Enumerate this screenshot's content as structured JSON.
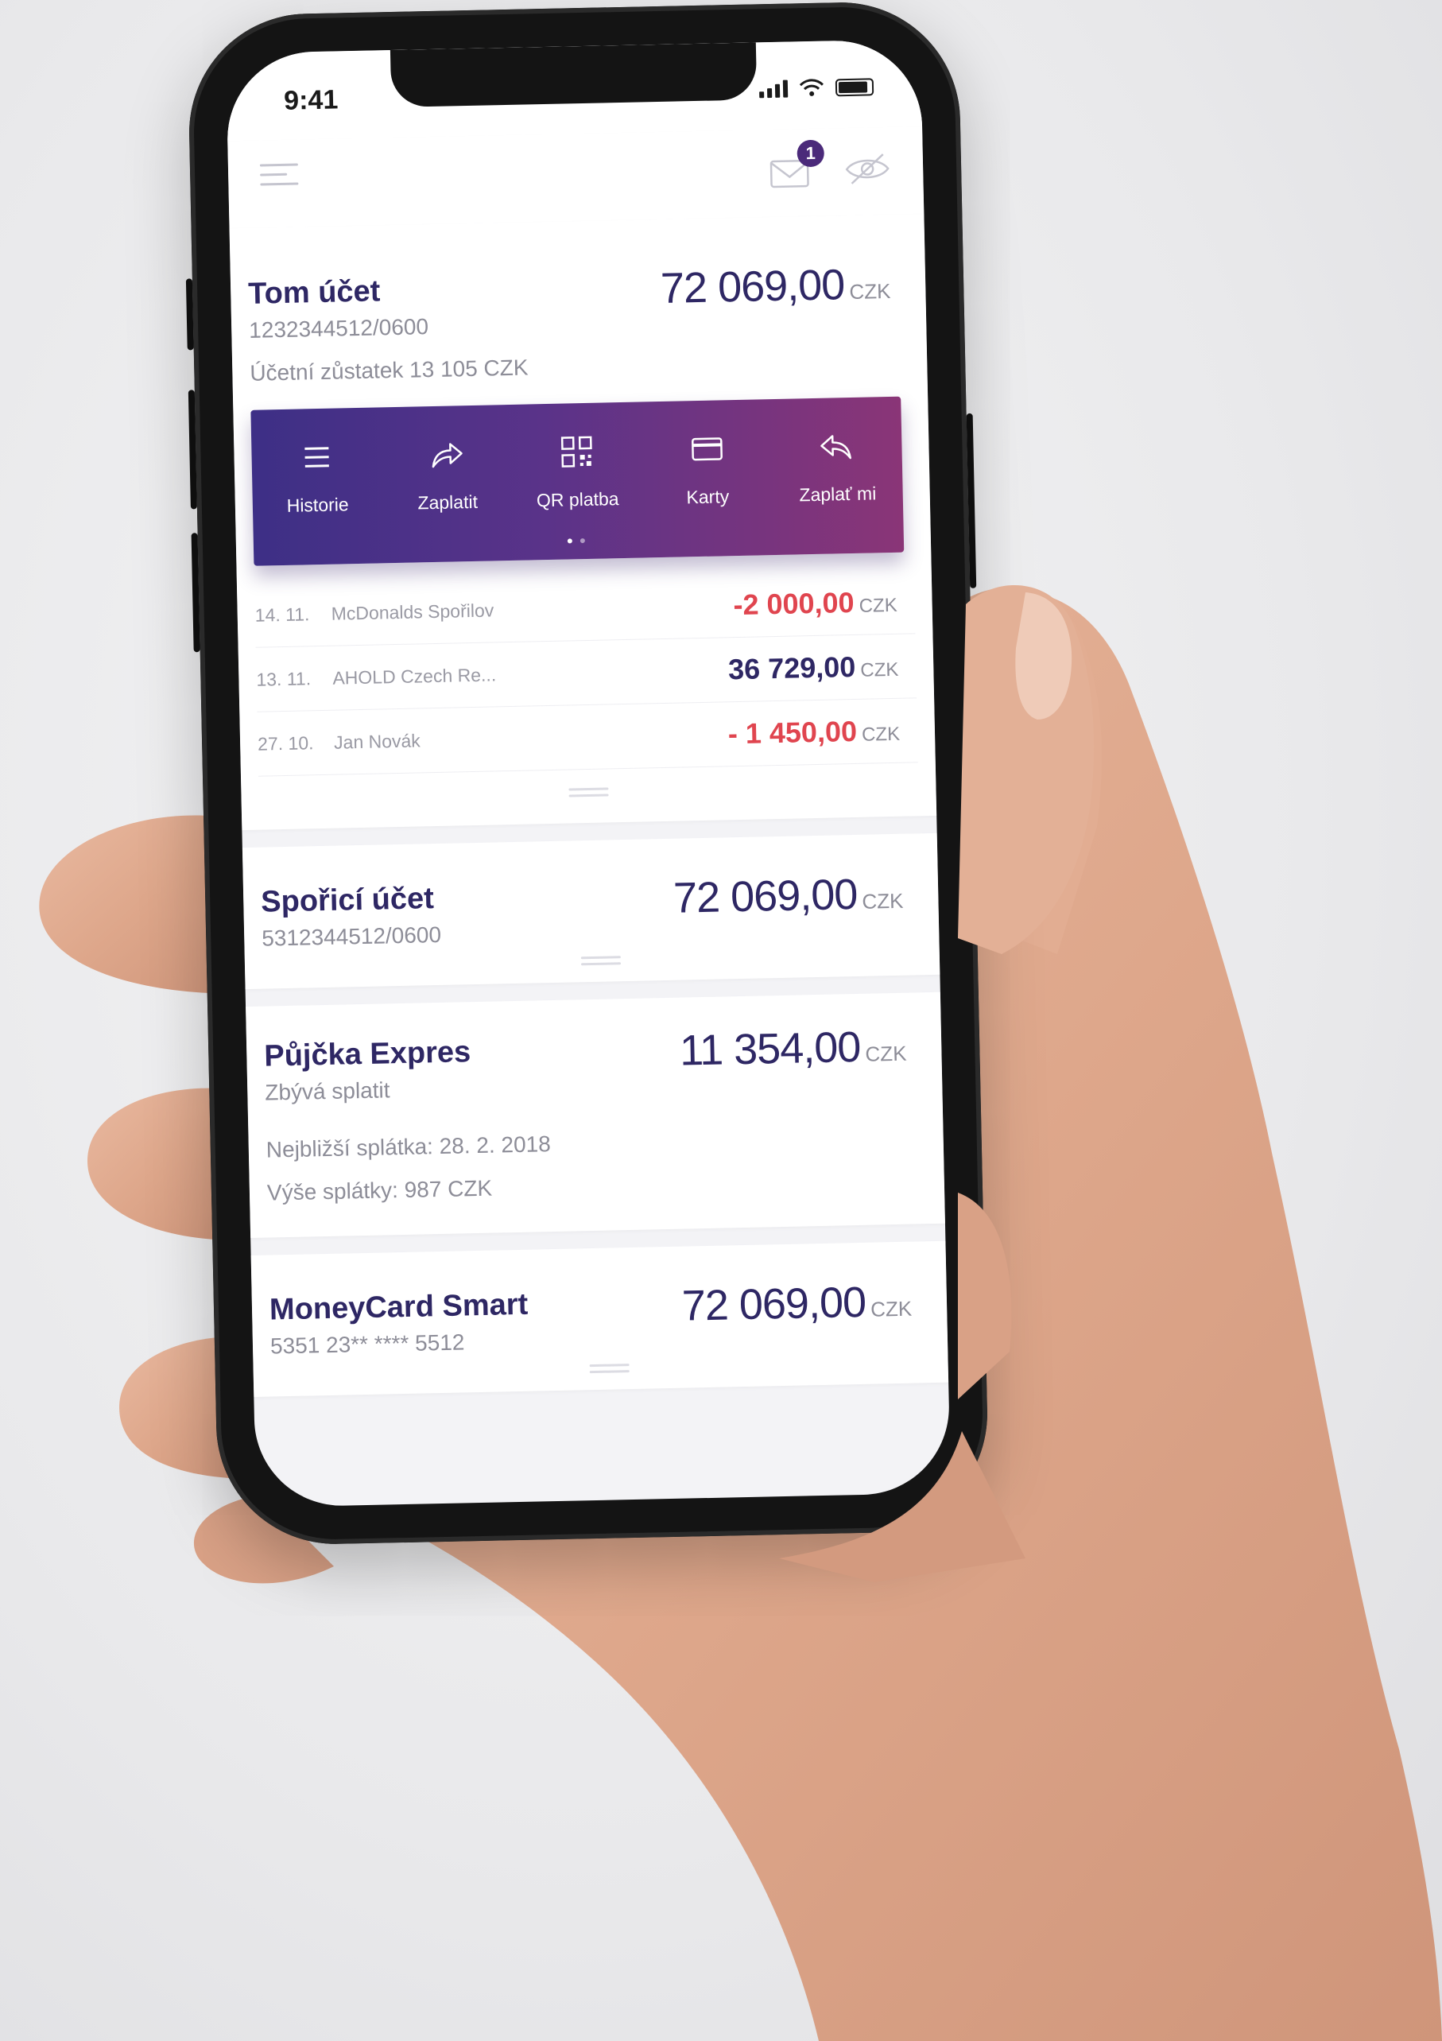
{
  "status_bar": {
    "time": "9:41"
  },
  "app_bar": {
    "notification_count": "1"
  },
  "main_account": {
    "name": "Tom účet",
    "number": "1232344512/0600",
    "accounting_balance": "Účetní zůstatek 13 105 CZK",
    "amount": "72 069,00",
    "currency": "CZK"
  },
  "actions": [
    {
      "label": "Historie",
      "icon": "list-icon"
    },
    {
      "label": "Zaplatit",
      "icon": "share-arrow-icon"
    },
    {
      "label": "QR platba",
      "icon": "qr-code-icon"
    },
    {
      "label": "Karty",
      "icon": "card-icon"
    },
    {
      "label": "Zaplať mi",
      "icon": "reply-arrow-icon"
    }
  ],
  "transactions": [
    {
      "date": "14. 11.",
      "description": "McDonalds Spořilov",
      "amount": "-2 000,00",
      "currency": "CZK",
      "type": "negative"
    },
    {
      "date": "13. 11.",
      "description": "AHOLD Czech Re...",
      "amount": "36 729,00",
      "currency": "CZK",
      "type": "positive"
    },
    {
      "date": "27. 10.",
      "description": "Jan Novák",
      "amount": "- 1 450,00",
      "currency": "CZK",
      "type": "negative"
    }
  ],
  "savings_account": {
    "name": "Spořicí účet",
    "number": "5312344512/0600",
    "amount": "72 069,00",
    "currency": "CZK"
  },
  "loan": {
    "name": "Půjčka Expres",
    "remaining_label": "Zbývá splatit",
    "next_payment": "Nejbližší splátka: 28. 2. 2018",
    "payment_amount": "Výše splátky: 987 CZK",
    "amount": "11 354,00",
    "currency": "CZK"
  },
  "card": {
    "name": "MoneyCard Smart",
    "number": "5351 23** **** 5512",
    "amount": "72 069,00",
    "currency": "CZK"
  },
  "colors": {
    "brand_dark": "#2e2764",
    "gradient_start": "#3d2f86",
    "gradient_end": "#8a3577",
    "negative": "#e0454f"
  }
}
